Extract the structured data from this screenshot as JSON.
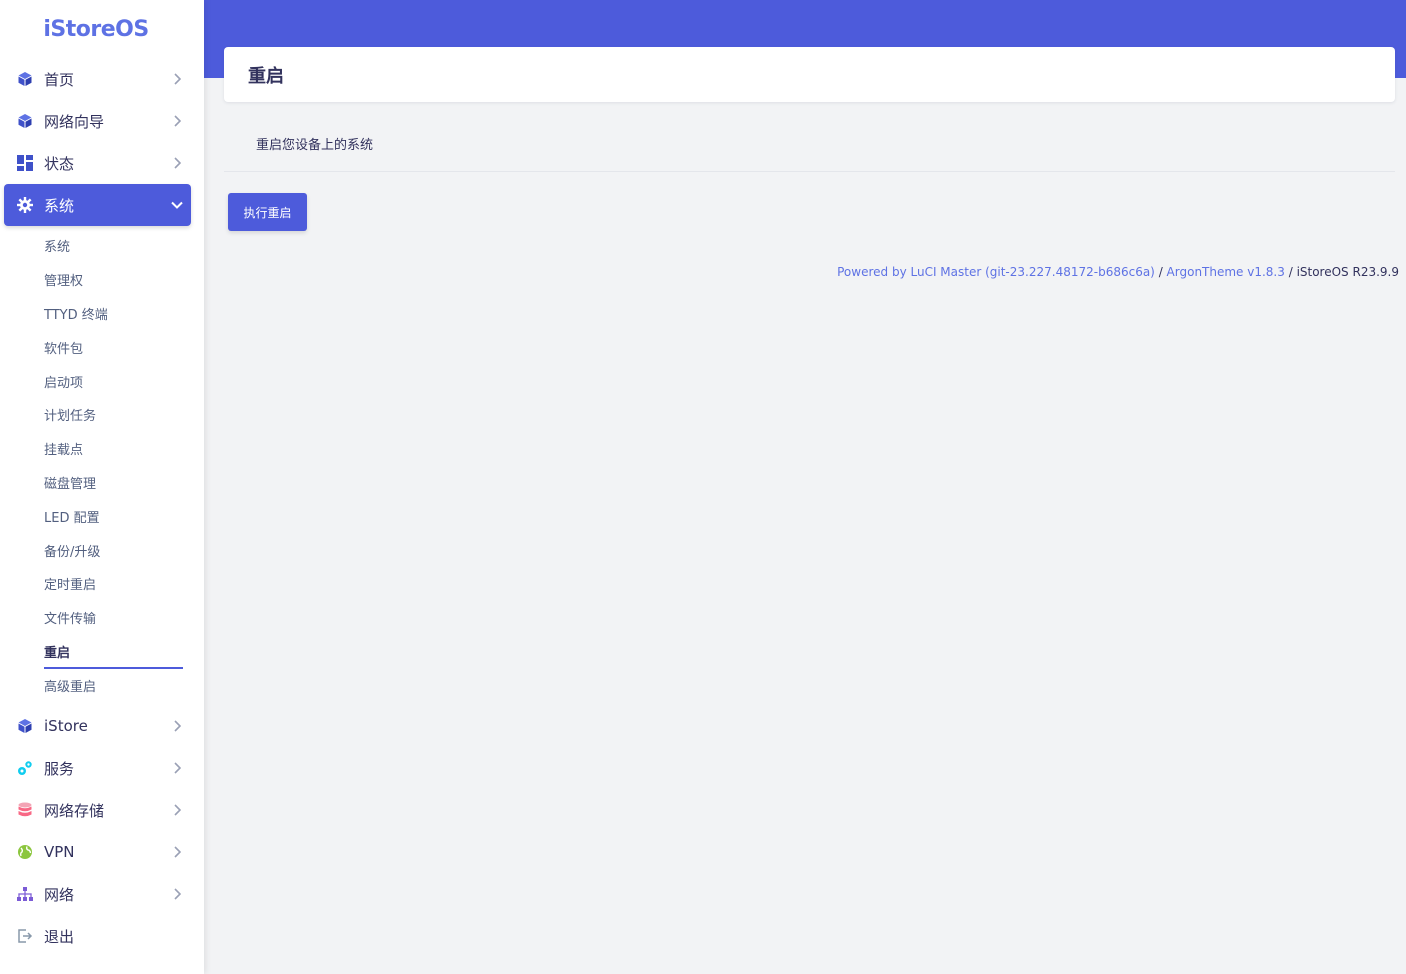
{
  "brand": {
    "name_part1": "iStore",
    "name_part2": "OS"
  },
  "colors": {
    "accent": "#4d5bdb",
    "brand": "#5e72e4"
  },
  "menu": [
    {
      "label": "首页",
      "icon": "cube-icon",
      "active": false
    },
    {
      "label": "网络向导",
      "icon": "cube-icon",
      "active": false
    },
    {
      "label": "状态",
      "icon": "dashboard-icon",
      "active": false
    },
    {
      "label": "系统",
      "icon": "gear-icon",
      "active": true
    },
    {
      "label": "iStore",
      "icon": "cube-icon",
      "active": false
    },
    {
      "label": "服务",
      "icon": "cogs-icon",
      "active": false
    },
    {
      "label": "网络存储",
      "icon": "database-icon",
      "active": false
    },
    {
      "label": "VPN",
      "icon": "globe-icon",
      "active": false
    },
    {
      "label": "网络",
      "icon": "sitemap-icon",
      "active": false
    },
    {
      "label": "退出",
      "icon": "logout-icon",
      "active": false
    }
  ],
  "submenu": [
    {
      "label": "系统"
    },
    {
      "label": "管理权"
    },
    {
      "label": "TTYD 终端"
    },
    {
      "label": "软件包"
    },
    {
      "label": "启动项"
    },
    {
      "label": "计划任务"
    },
    {
      "label": "挂载点"
    },
    {
      "label": "磁盘管理"
    },
    {
      "label": "LED 配置"
    },
    {
      "label": "备份/升级"
    },
    {
      "label": "定时重启"
    },
    {
      "label": "文件传输"
    },
    {
      "label": "重启",
      "current": true
    },
    {
      "label": "高级重启"
    }
  ],
  "page": {
    "title": "重启",
    "description": "重启您设备上的系统",
    "button_label": "执行重启"
  },
  "footer": {
    "luci_link": "Powered by LuCI Master (git-23.227.48172-b686c6a)",
    "sep1": " / ",
    "theme_link": "ArgonTheme v1.8.3",
    "sep2": " / ",
    "version": "iStoreOS R23.9.9"
  }
}
